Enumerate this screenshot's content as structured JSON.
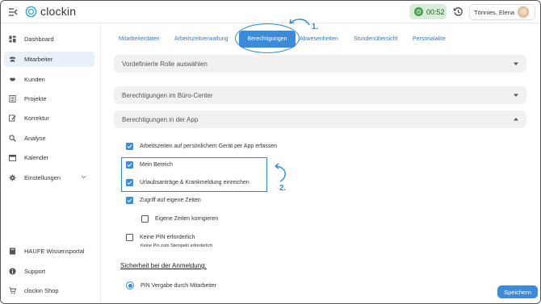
{
  "app": {
    "name": "clockin"
  },
  "topbar": {
    "timer": "00:52",
    "user_name": "Tönnies, Elena"
  },
  "sidebar": {
    "items": [
      {
        "label": "Dashboard",
        "icon": "dashboard-icon",
        "active": false
      },
      {
        "label": "Mitarbeiter",
        "icon": "users-icon",
        "active": true
      },
      {
        "label": "Kunden",
        "icon": "handshake-icon",
        "active": false
      },
      {
        "label": "Projekte",
        "icon": "projects-icon",
        "active": false
      },
      {
        "label": "Korrektur",
        "icon": "correction-icon",
        "active": false
      },
      {
        "label": "Analyse",
        "icon": "search-icon",
        "active": false
      },
      {
        "label": "Kalender",
        "icon": "calendar-icon",
        "active": false
      },
      {
        "label": "Einstellungen",
        "icon": "gear-icon",
        "active": false
      }
    ],
    "bottom_items": [
      {
        "label": "HAUFE Wissensportal",
        "icon": "book-icon"
      },
      {
        "label": "Support",
        "icon": "info-icon"
      },
      {
        "label": "clockin Shop",
        "icon": "cart-icon"
      }
    ]
  },
  "tabs": [
    {
      "label": "Mitarbeiterdaten",
      "active": false
    },
    {
      "label": "Arbeitszeitverwaltung",
      "active": false
    },
    {
      "label": "Berechtigungen",
      "active": true
    },
    {
      "label": "Abwesenheiten",
      "active": false
    },
    {
      "label": "Stundenübersicht",
      "active": false
    },
    {
      "label": "Personalakte",
      "active": false
    }
  ],
  "annotations": {
    "step1": "1.",
    "step2": "2."
  },
  "accordions": {
    "predefined_role": "Vordefinierte Rolle auswählen",
    "office_center": "Berechtigungen im Büro-Center",
    "in_app": "Berechtigungen in der App"
  },
  "permissions": {
    "personal_device": {
      "label": "Arbeitszeiten auf persönlichem Gerät per App erfassen",
      "checked": true
    },
    "my_area": {
      "label": "Mein Bereich",
      "checked": true
    },
    "leave_sick": {
      "label": "Urlaubsanträge & Krankmeldung einreichen",
      "checked": true
    },
    "own_times": {
      "label": "Zugriff auf eigene Zeiten",
      "checked": true
    },
    "correct_own_times": {
      "label": "Eigene Zeiten korrigieren",
      "checked": false
    },
    "no_pin": {
      "label": "Keine PIN erforderlich",
      "checked": false
    },
    "no_pin_note": "Keine Pin zum Stempeln erforderlich"
  },
  "login_security": {
    "title": "Sicherheit bei der Anmeldung:",
    "option": "PIN Vergabe durch Mitarbeiter"
  },
  "actions": {
    "save": "Speichern"
  },
  "colors": {
    "accent": "#3d8bd8",
    "timer_bg": "#d6eed7",
    "timer_dot": "#3aa040",
    "active_nav_bg": "#e8f0f9",
    "accordion_bg": "#f1f1f1"
  }
}
